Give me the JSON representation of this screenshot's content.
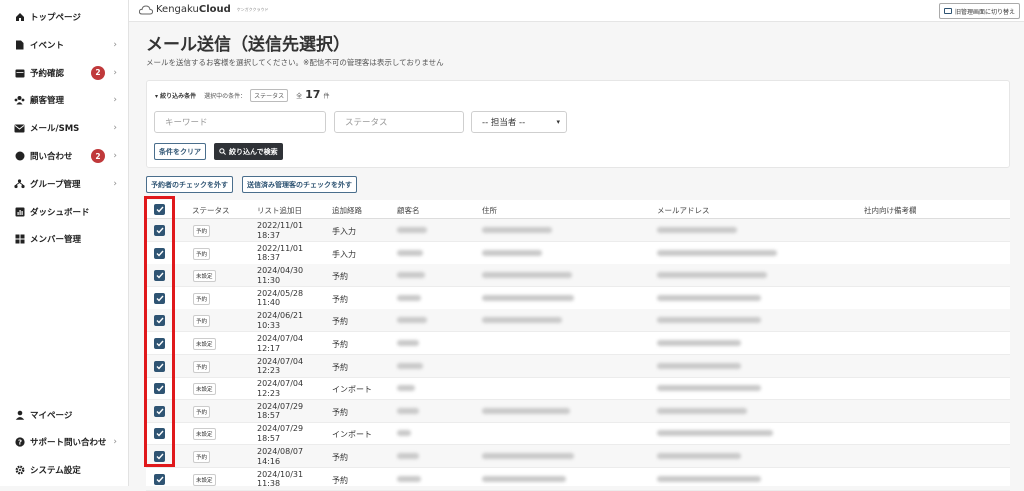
{
  "app": {
    "brand_prefix": "Kengaku",
    "brand_bold": "Cloud",
    "brand_sub": "ケンガククラウド",
    "switch_label": "旧管理画面に切り替え"
  },
  "sidebar": {
    "items": [
      {
        "label": "トップページ",
        "icon": "home-icon",
        "chevron": false,
        "badge": null
      },
      {
        "label": "イベント",
        "icon": "document-icon",
        "chevron": true,
        "badge": null
      },
      {
        "label": "予約確認",
        "icon": "calendar-icon",
        "chevron": true,
        "badge": "2"
      },
      {
        "label": "顧客管理",
        "icon": "users-icon",
        "chevron": true,
        "badge": null
      },
      {
        "label": "メール/SMS",
        "icon": "mail-icon",
        "chevron": true,
        "badge": null
      },
      {
        "label": "問い合わせ",
        "icon": "chat-icon",
        "chevron": true,
        "badge": "2"
      },
      {
        "label": "グループ管理",
        "icon": "group-icon",
        "chevron": true,
        "badge": null
      },
      {
        "label": "ダッシュボード",
        "icon": "chart-icon",
        "chevron": false,
        "badge": null
      },
      {
        "label": "メンバー管理",
        "icon": "grid-icon",
        "chevron": false,
        "badge": null
      }
    ],
    "bottom_items": [
      {
        "label": "マイページ",
        "icon": "person-icon",
        "chevron": false
      },
      {
        "label": "サポート問い合わせ",
        "icon": "help-icon",
        "chevron": true
      },
      {
        "label": "システム設定",
        "icon": "gear-icon",
        "chevron": false
      }
    ]
  },
  "page": {
    "title": "メール送信（送信先選択）",
    "description": "メールを送信するお客様を選択してください。※配信不可の管理客は表示しておりません"
  },
  "filter": {
    "title": "▾ 絞り込み条件",
    "current_label": "選択中の条件：",
    "current_tag": "ステータス",
    "total_prefix": "全",
    "total_count": "17",
    "total_suffix": "件",
    "keyword_placeholder": "キーワード",
    "status_placeholder": "ステータス",
    "assignee_selected": "-- 担当者 --",
    "clear_label": "条件をクリア",
    "search_label": "絞り込んで検索"
  },
  "actions": {
    "uncheck_reserved": "予約者のチェックを外す",
    "uncheck_sent": "送信済み管理客のチェックを外す"
  },
  "table": {
    "columns": [
      "ステータス",
      "リスト追加日",
      "追加経路",
      "顧客名",
      "住所",
      "メールアドレス",
      "社内向け備考欄"
    ],
    "rows": [
      {
        "status": "予約",
        "date": "2022/11/01",
        "time": "18:37",
        "route": "手入力"
      },
      {
        "status": "予約",
        "date": "2022/11/01",
        "time": "18:37",
        "route": "手入力"
      },
      {
        "status": "未設定",
        "date": "2024/04/30",
        "time": "11:30",
        "route": "予約"
      },
      {
        "status": "予約",
        "date": "2024/05/28",
        "time": "11:40",
        "route": "予約"
      },
      {
        "status": "予約",
        "date": "2024/06/21",
        "time": "10:33",
        "route": "予約"
      },
      {
        "status": "未設定",
        "date": "2024/07/04",
        "time": "12:17",
        "route": "予約"
      },
      {
        "status": "予約",
        "date": "2024/07/04",
        "time": "12:23",
        "route": "予約"
      },
      {
        "status": "未設定",
        "date": "2024/07/04",
        "time": "12:23",
        "route": "インポート"
      },
      {
        "status": "予約",
        "date": "2024/07/29",
        "time": "18:57",
        "route": "予約"
      },
      {
        "status": "未設定",
        "date": "2024/07/29",
        "time": "18:57",
        "route": "インポート"
      },
      {
        "status": "予約",
        "date": "2024/08/07",
        "time": "14:16",
        "route": "予約"
      },
      {
        "status": "未設定",
        "date": "2024/10/31",
        "time": "11:38",
        "route": "予約"
      }
    ]
  },
  "colors": {
    "primary": "#2f5473",
    "badge": "#c0393b",
    "highlight": "#e0181b",
    "dark_button": "#2f3237"
  }
}
